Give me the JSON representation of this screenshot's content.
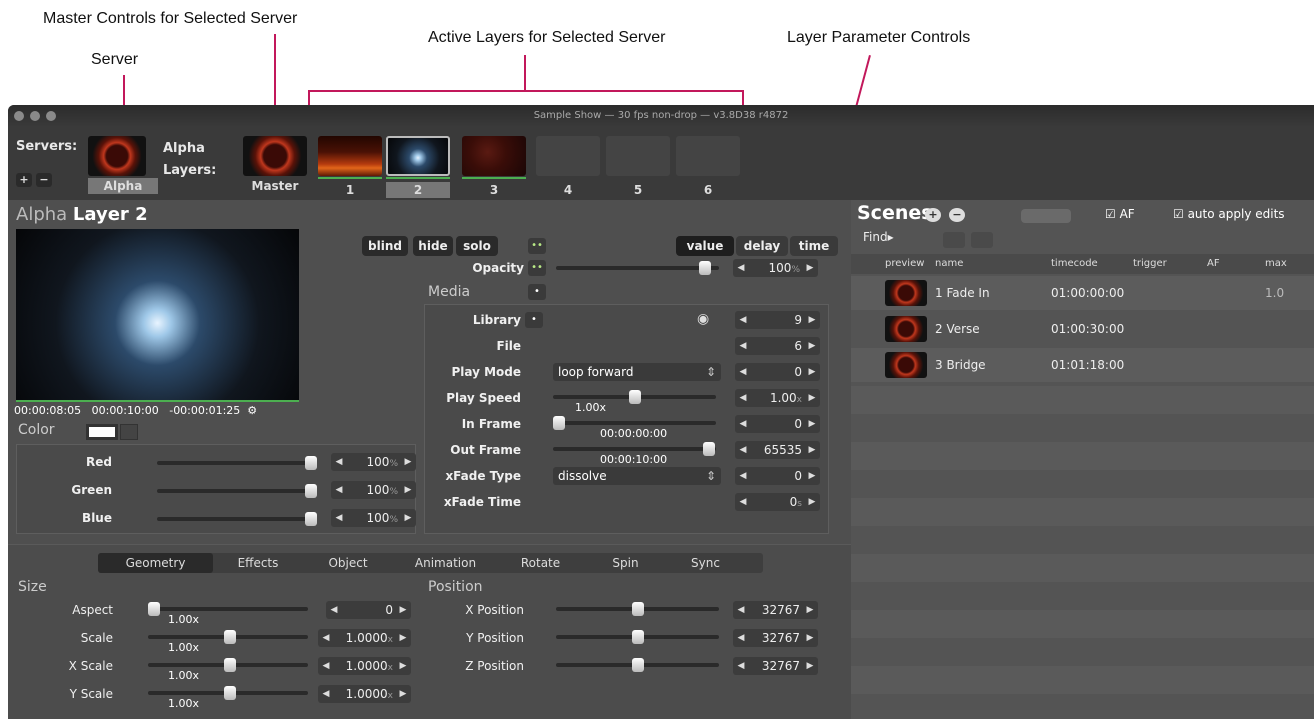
{
  "callouts": {
    "master": "Master Controls for Selected Server",
    "server": "Server",
    "active_layers": "Active Layers for Selected Server",
    "param_controls": "Layer Parameter Controls"
  },
  "window": {
    "title": "Sample Show  —  30 fps non-drop  —  v3.8D38 r4872"
  },
  "servers": {
    "label": "Servers:",
    "add": "+",
    "remove": "−",
    "server_name": "Alpha",
    "layers_label_top": "Alpha",
    "layers_label_bottom": "Layers:",
    "master": "Master"
  },
  "layers": [
    {
      "label": "1"
    },
    {
      "label": "2"
    },
    {
      "label": "3"
    },
    {
      "label": "4"
    },
    {
      "label": "5"
    },
    {
      "label": "6"
    }
  ],
  "layer_title": {
    "server": "Alpha",
    "layer": "Layer 2"
  },
  "timecode": {
    "current": "00:00:08:05",
    "duration": "00:00:10:00",
    "remaining": "-00:00:01:25",
    "gear": "⚙"
  },
  "color": {
    "label": "Color",
    "rows": [
      {
        "label": "Red",
        "value": "100",
        "unit": "%"
      },
      {
        "label": "Green",
        "value": "100",
        "unit": "%"
      },
      {
        "label": "Blue",
        "value": "100",
        "unit": "%"
      }
    ]
  },
  "buttons": {
    "blind": "blind",
    "hide": "hide",
    "solo": "solo",
    "value": "value",
    "delay": "delay",
    "time": "time",
    "dots": "••"
  },
  "opacity": {
    "label": "Opacity",
    "value": "100",
    "unit": "%",
    "level": 0.95
  },
  "media": {
    "label": "Media",
    "library": "Library",
    "library_value": "9",
    "file": "File",
    "file_value": "6",
    "play_mode": "Play Mode",
    "play_mode_value": "loop forward",
    "play_mode_num": "0",
    "play_speed": "Play Speed",
    "play_speed_value": "1.00x",
    "play_speed_num": "1.00",
    "play_speed_unit": "x",
    "in_frame": "In Frame",
    "in_frame_tc": "00:00:00:00",
    "in_frame_num": "0",
    "out_frame": "Out Frame",
    "out_frame_tc": "00:00:10:00",
    "out_frame_num": "65535",
    "xfade_type": "xFade Type",
    "xfade_type_value": "dissolve",
    "xfade_type_num": "0",
    "xfade_time": "xFade Time",
    "xfade_time_num": "0",
    "xfade_time_unit": "s"
  },
  "tabs": [
    "Geometry",
    "Effects",
    "Object",
    "Animation",
    "Rotate",
    "Spin",
    "Sync"
  ],
  "size": {
    "label": "Size",
    "rows": [
      {
        "label": "Aspect",
        "slider": "1.00x",
        "value": "0",
        "unit": ""
      },
      {
        "label": "Scale",
        "slider": "1.00x",
        "value": "1.0000",
        "unit": "x"
      },
      {
        "label": "X Scale",
        "slider": "1.00x",
        "value": "1.0000",
        "unit": "x"
      },
      {
        "label": "Y Scale",
        "slider": "1.00x",
        "value": "1.0000",
        "unit": "x"
      }
    ]
  },
  "position": {
    "label": "Position",
    "rows": [
      {
        "label": "X Position",
        "value": "32767"
      },
      {
        "label": "Y Position",
        "value": "32767"
      },
      {
        "label": "Z Position",
        "value": "32767"
      }
    ]
  },
  "scenes": {
    "title": "Scenes",
    "add": "+",
    "remove": "−",
    "af": "AF",
    "auto_apply": "auto apply edits",
    "find": "Find▸",
    "columns": [
      "preview",
      "name",
      "timecode",
      "trigger",
      "AF",
      "max"
    ],
    "rows": [
      {
        "name": "1 Fade In",
        "timecode": "01:00:00:00",
        "max": "1.0"
      },
      {
        "name": "2 Verse",
        "timecode": "01:00:30:00",
        "max": ""
      },
      {
        "name": "3 Bridge",
        "timecode": "01:01:18:00",
        "max": ""
      }
    ]
  }
}
